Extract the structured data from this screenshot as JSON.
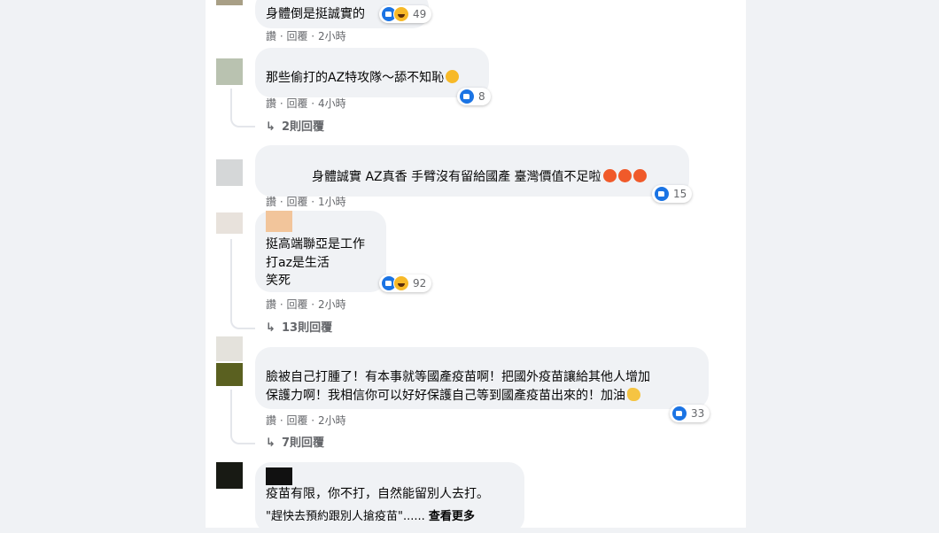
{
  "comments": [
    {
      "lines": [
        "身體倒是挺誠實的"
      ],
      "meta": {
        "like": "讚",
        "reply": "回覆",
        "time": "2小時"
      },
      "reaction_count": "49",
      "reaction_icons": [
        "like-icon",
        "haha-icon"
      ]
    },
    {
      "lines": [
        "那些偷打的AZ特攻隊～舔不知恥"
      ],
      "emoji": "rofl-emoji",
      "meta": {
        "like": "讚",
        "reply": "回覆",
        "time": "4小時"
      },
      "reaction_count": "8",
      "reaction_icons": [
        "like-icon"
      ],
      "replies_label": "2則回覆"
    },
    {
      "lines": [
        "身體誠實 AZ真香 手臂沒有留給國產 臺灣價值不足啦"
      ],
      "emoji": "wow-emoji x3",
      "meta": {
        "like": "讚",
        "reply": "回覆",
        "time": "1小時"
      },
      "reaction_count": "15",
      "reaction_icons": [
        "like-icon"
      ]
    },
    {
      "lines": [
        "挺高端聯亞是工作",
        "打az是生活",
        "笑死"
      ],
      "meta": {
        "like": "讚",
        "reply": "回覆",
        "time": "2小時"
      },
      "reaction_count": "92",
      "reaction_icons": [
        "like-icon",
        "haha-icon"
      ],
      "replies_label": "13則回覆"
    },
    {
      "lines": [
        "臉被自己打腫了！有本事就等國產疫苗啊！把國外疫苗讓給其他人增加",
        "保護力啊！我相信你可以好好保護自己等到國產疫苗出來的！加油"
      ],
      "emoji": "muscle-emoji",
      "meta": {
        "like": "讚",
        "reply": "回覆",
        "time": "2小時"
      },
      "reaction_count": "33",
      "reaction_icons": [
        "like-icon"
      ],
      "replies_label": "7則回覆"
    },
    {
      "lines": [
        "疫苗有限，你不打，自然能留別人去打。",
        "\"趕快去預約跟別人搶疫苗\"......"
      ],
      "see_more": "查看更多"
    }
  ],
  "colors": {
    "page_bg": "#f0f2f5",
    "panel_bg": "#ffffff",
    "bubble_bg": "#f0f2f5",
    "meta_text": "#65676b",
    "like_blue": "#1b74e4"
  }
}
